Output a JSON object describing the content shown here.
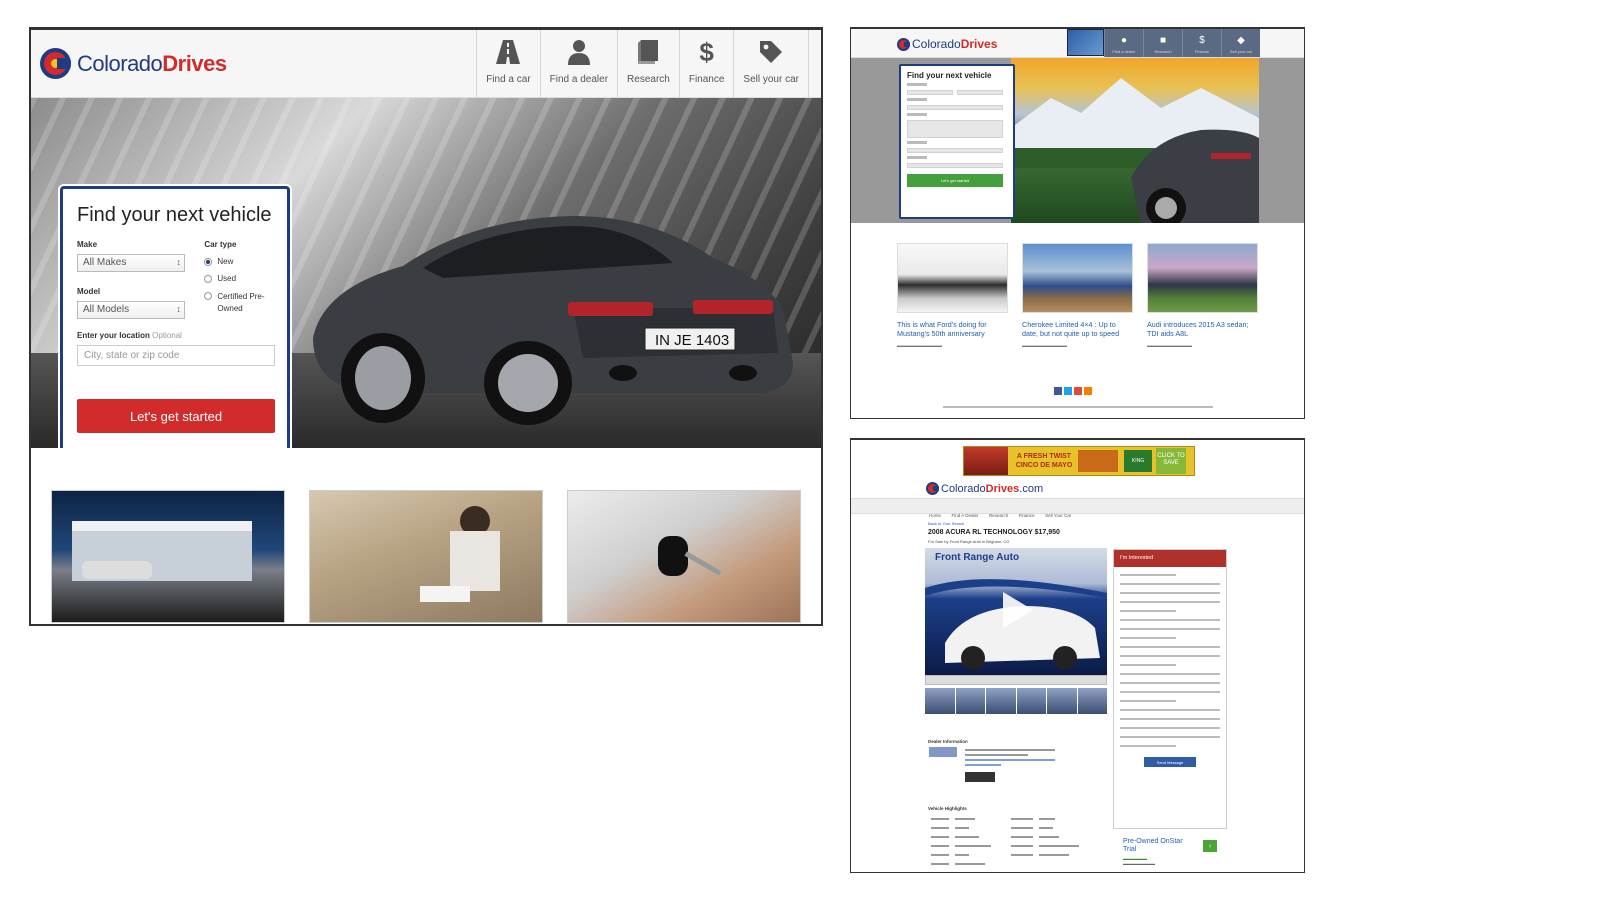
{
  "main": {
    "logo": {
      "part1": "Colorado",
      "part2": "Drives"
    },
    "nav": [
      {
        "label": "Find a car",
        "icon": "road-icon"
      },
      {
        "label": "Find a dealer",
        "icon": "person-icon"
      },
      {
        "label": "Research",
        "icon": "book-icon"
      },
      {
        "label": "Finance",
        "icon": "dollar-icon"
      },
      {
        "label": "Sell your car",
        "icon": "tag-icon"
      }
    ],
    "search": {
      "title": "Find your next vehicle",
      "make_label": "Make",
      "make_value": "All Makes",
      "model_label": "Model",
      "model_value": "All Models",
      "cartype_label": "Car type",
      "cartype_options": [
        "New",
        "Used",
        "Certified Pre-Owned"
      ],
      "cartype_selected": "New",
      "location_label": "Enter your location",
      "location_optional": "Optional",
      "location_placeholder": "City, state or zip code",
      "cta": "Let's get started"
    },
    "plate": "IN JE 1403"
  },
  "top_right": {
    "logo": {
      "part1": "Colorado",
      "part2": "Drives"
    },
    "nav": [
      "Find a dealer",
      "Research",
      "Finance",
      "Sell your car"
    ],
    "card_title": "Find your next vehicle",
    "card_cta": "Let's get started",
    "articles": [
      {
        "title": "This is what Ford's doing for Mustang's 50th anniversary"
      },
      {
        "title": "Cherokee Limited 4×4 : Up to date, but not quite up to speed"
      },
      {
        "title": "Audi introduces 2015 A3 sedan; TDI aids A8L"
      }
    ]
  },
  "bottom_right": {
    "banner_text": "A FRESH TWIST CINCO DE MAYO",
    "banner_cta": "CLICK TO SAVE",
    "logo": {
      "part1": "Colorado",
      "part2": "Drives",
      "suffix": ".com"
    },
    "nav": [
      "Home",
      "Find A Dealer",
      "Research",
      "Finance",
      "Sell Your Car"
    ],
    "back_link": "Back to Your Search",
    "listing_title": "2008 ACURA RL TECHNOLOGY $17,950",
    "listing_sub": "For Sale by Front Range Auto in Brighton, CO",
    "video_title": "Front Range Auto",
    "dealer_heading": "Dealer Information",
    "highlights_heading": "Vehicle Highlights",
    "interest_title": "I'm Interested",
    "send_label": "Send Message",
    "promo_title": "Pre-Owned OnStar Trial"
  },
  "colors": {
    "brand_blue": "#1f3b82",
    "brand_red": "#d12b2b",
    "link_blue": "#1f5fb4"
  }
}
